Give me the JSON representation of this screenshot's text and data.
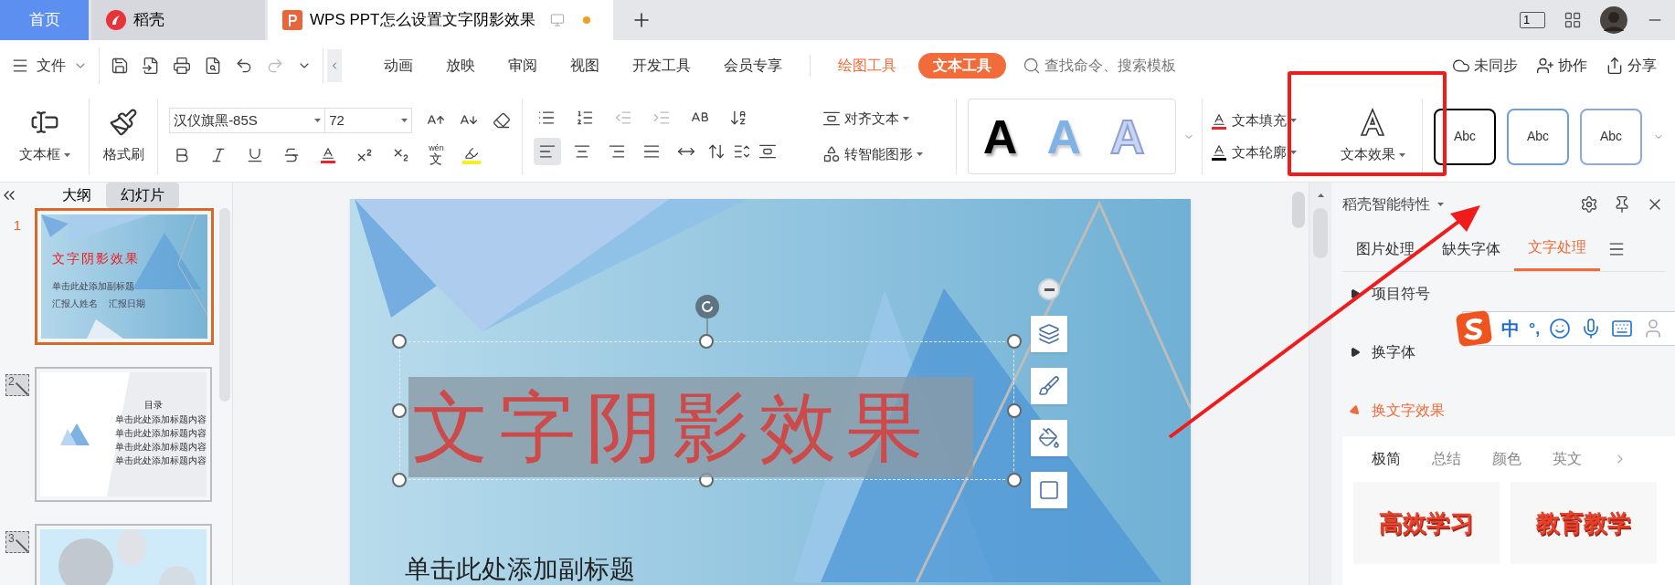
{
  "tabs": [
    {
      "label": "首页",
      "kind": "home",
      "selected": false
    },
    {
      "label": "稻壳",
      "kind": "docer",
      "selected": false
    },
    {
      "label": "WPS PPT怎么设置文字阴影效果",
      "kind": "doc",
      "selected": true
    }
  ],
  "window_controls": {
    "screen_badge": "1"
  },
  "menu": {
    "file": "文件",
    "tabs": [
      {
        "label": "动画",
        "kind": "plain",
        "selected": false
      },
      {
        "label": "放映",
        "kind": "plain",
        "selected": false
      },
      {
        "label": "审阅",
        "kind": "plain",
        "selected": false
      },
      {
        "label": "视图",
        "kind": "plain",
        "selected": false
      },
      {
        "label": "开发工具",
        "kind": "plain",
        "selected": false
      },
      {
        "label": "会员专享",
        "kind": "plain",
        "selected": false
      },
      {
        "label": "绘图工具",
        "kind": "context",
        "selected": false
      },
      {
        "label": "文本工具",
        "kind": "context",
        "selected": true
      }
    ],
    "search": {
      "placeholder": "查找命令、搜索模板"
    },
    "actions": [
      {
        "label": "未同步",
        "kind": "sync"
      },
      {
        "label": "协作",
        "kind": "collab"
      },
      {
        "label": "分享",
        "kind": "share"
      }
    ]
  },
  "ribbon": {
    "textbox": "文本框",
    "format_painter": "格式刷",
    "font": "汉仪旗黑-85S",
    "size": "72",
    "phonetic": {
      "top": "wén",
      "bottom": "文"
    },
    "alignment": [
      {
        "kind": "left",
        "selected": true
      },
      {
        "kind": "center",
        "selected": false
      },
      {
        "kind": "right",
        "selected": false
      },
      {
        "kind": "justify",
        "selected": false
      },
      {
        "kind": "distributed",
        "selected": false
      }
    ],
    "align_text": "对齐文本",
    "smartart": "转智能图形",
    "wordart": [
      {
        "label": "A",
        "kind": "solid"
      },
      {
        "label": "A",
        "kind": "gradient"
      },
      {
        "label": "A",
        "kind": "outline"
      }
    ],
    "text_fill": "文本填充",
    "text_outline": "文本轮廓",
    "text_effect": "文本效果",
    "shape_styles": [
      {
        "label": "Abc",
        "color": "#000000"
      },
      {
        "label": "Abc",
        "color": "#6fa0dc"
      },
      {
        "label": "Abc",
        "color": "#8fa8dc"
      }
    ]
  },
  "slide_panel": {
    "tabs": [
      {
        "label": "大纲",
        "selected": false
      },
      {
        "label": "幻灯片",
        "selected": true
      }
    ],
    "slides": [
      {
        "number": "1",
        "kind": "title",
        "selected": true,
        "hidden": false,
        "title": "文字阴影效果",
        "subtitle": "单击此处添加副标题",
        "meta": [
          "汇报人姓名",
          "汇报日期"
        ]
      },
      {
        "number": "2",
        "kind": "toc",
        "selected": false,
        "hidden": true,
        "title": "目录",
        "items": [
          "单击此处添加标题内容",
          "单击此处添加标题内容",
          "单击此处添加标题内容",
          "单击此处添加标题内容"
        ]
      },
      {
        "number": "3",
        "kind": "picture",
        "selected": false,
        "hidden": true
      }
    ]
  },
  "slide": {
    "title": "文字阴影效果",
    "subtitle": "单击此处添加副标题"
  },
  "side_panel": {
    "title": "稻壳智能特性",
    "tabs": [
      {
        "label": "图片处理",
        "selected": false
      },
      {
        "label": "缺失字体",
        "selected": false
      },
      {
        "label": "文字处理",
        "selected": true
      }
    ],
    "sections": [
      {
        "label": "项目符号",
        "expanded": false
      },
      {
        "label": "换字体",
        "expanded": false
      },
      {
        "label": "换文字效果",
        "expanded": true
      }
    ],
    "effect_tabs": [
      {
        "label": "极简",
        "selected": true
      },
      {
        "label": "总结",
        "selected": false
      },
      {
        "label": "颜色",
        "selected": false
      },
      {
        "label": "英文",
        "selected": false
      }
    ],
    "effects": [
      "高效学习",
      "教育教学"
    ]
  },
  "ime": {
    "mode": "中",
    "punct": "°,"
  }
}
